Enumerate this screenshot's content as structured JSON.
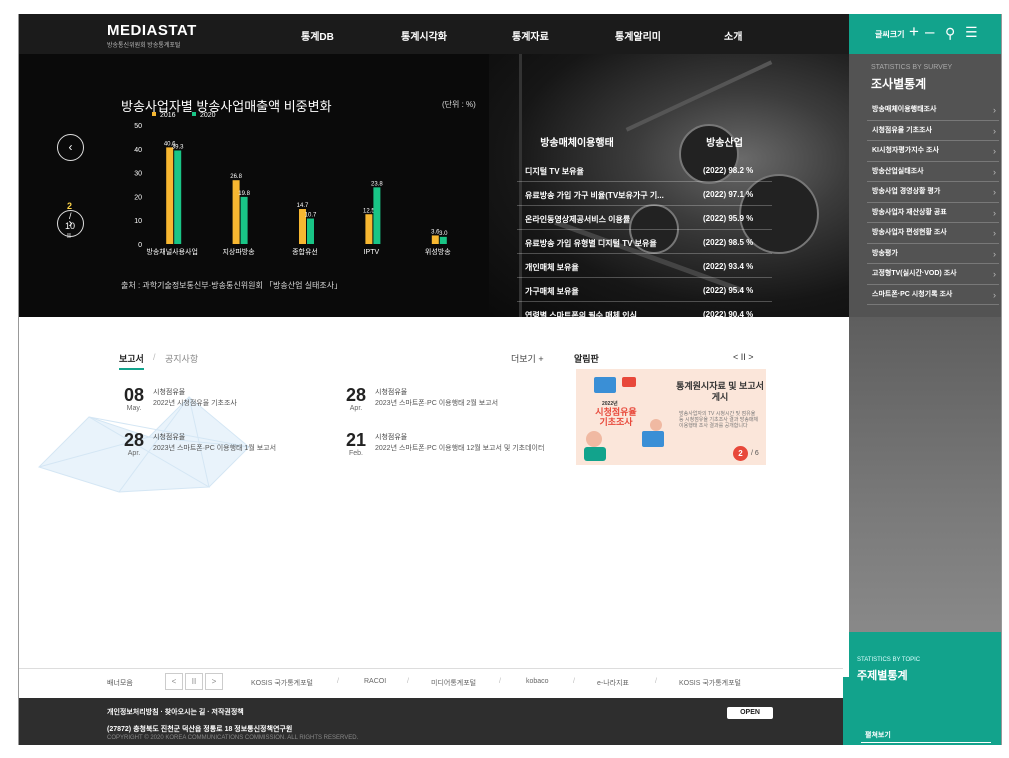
{
  "header": {
    "logo": "MEDIASTAT",
    "logo_sub": "방송통신위원회 방송통계포털",
    "nav": [
      "통계DB",
      "통계시각화",
      "통계자료",
      "통계알리미",
      "소개"
    ],
    "font_size_label": "글씨크기",
    "accent": "#12a38c"
  },
  "hero": {
    "chart_title": "방송사업자별 방송사업매출액 비중변화",
    "chart_unit": "(단위 : %)",
    "chart_source": "출처 : 과학기술정보통신부·방송통신위원회 「방송산업 실태조사」",
    "pager": {
      "current": "2",
      "slash": "/",
      "total": "10",
      "pause": "II"
    },
    "stat_tabs": [
      "방송매체이용행태",
      "방송산업"
    ],
    "stats": [
      {
        "label": "디지털 TV 보유율",
        "value": "(2022) 98.2 %"
      },
      {
        "label": "유료방송 가입 가구 비율(TV보유가구 기...",
        "value": "(2022) 97.1 %"
      },
      {
        "label": "온라인동영상제공서비스 이용률",
        "value": "(2022) 95.9 %"
      },
      {
        "label": "유료방송 가입 유형별 디지털 TV 보유율",
        "value": "(2022) 98.5 %"
      },
      {
        "label": "개인매체 보유율",
        "value": "(2022) 93.4 %"
      },
      {
        "label": "가구매체 보유율",
        "value": "(2022) 95.4 %"
      },
      {
        "label": "연령별 스마트폰의 필수 매체 인식",
        "value": "(2022) 90.4 %"
      }
    ]
  },
  "chart_data": {
    "type": "bar",
    "title": "방송사업자별 방송사업매출액 비중변화",
    "ylabel": "",
    "xlabel": "",
    "ylim": [
      0,
      50
    ],
    "yticks": [
      0,
      10,
      20,
      30,
      40,
      50
    ],
    "categories": [
      "방송채널사용사업",
      "지상파방송",
      "종합유선",
      "IPTV",
      "위성방송"
    ],
    "series": [
      {
        "name": "2016",
        "values": [
          40.6,
          26.8,
          14.7,
          12.5,
          3.6
        ],
        "color": "#f7b731"
      },
      {
        "name": "2020",
        "values": [
          39.3,
          19.8,
          10.7,
          23.8,
          3.0
        ],
        "color": "#19c586"
      }
    ],
    "legend_position": "top-left",
    "grid": false
  },
  "sidebar": {
    "survey_en": "STATISTICS BY SURVEY",
    "survey_ko": "조사별통계",
    "items": [
      "방송매체이용행태조사",
      "시청점유율 기초조사",
      "KI시청자평가지수 조사",
      "방송산업실태조사",
      "방송사업 경영상황 평가",
      "방송사업자 재산상황 공표",
      "방송사업자 편성현황 조사",
      "방송평가",
      "고정형TV(실시간·VOD) 조사",
      "스마트폰·PC 시청기록 조사"
    ],
    "topic_en": "STATISTICS BY TOPIC",
    "topic_ko": "주제별통계",
    "expand": "펼쳐보기"
  },
  "news": {
    "tab_reports": "보고서",
    "tab_sep": "/",
    "tab_notice": "공지사항",
    "more": "더보기 +",
    "items": [
      {
        "day": "08",
        "month": "May.",
        "category": "시청점유율",
        "title": "2022년 시청점유율 기초조사"
      },
      {
        "day": "28",
        "month": "Apr.",
        "category": "시청점유율",
        "title": "2023년 스마트폰·PC 이용행태 2월 보고서"
      },
      {
        "day": "28",
        "month": "Apr.",
        "category": "시청점유율",
        "title": "2023년 스마트폰·PC 이용행태 1월 보고서"
      },
      {
        "day": "21",
        "month": "Feb.",
        "category": "시청점유율",
        "title": "2022년 스마트폰·PC 이용행태 12월 보고서 및 기초데이터"
      }
    ]
  },
  "notice": {
    "title": "알림판",
    "controls": "< II >",
    "banner_title": "통계원시자료 및 보고서 게시",
    "banner_body": "방송사업자의 TV 시청시간 및 점유율 등 시청점유율 기초조사 결과 방송매체 이용행태 조사 결과를 공개합니다",
    "banner_year": "2022년",
    "banner_tag": "시청점유율 기초조사",
    "page_current": "2",
    "page_total": "/ 6"
  },
  "links": {
    "label": "배너모음",
    "controls": [
      "<",
      "II",
      ">"
    ],
    "items": [
      "KOSIS 국가통계포털",
      "RACOI",
      "미디어통계포털",
      "kobaco",
      "e-나라지표",
      "KOSIS 국가통계포털"
    ],
    "sep": "/"
  },
  "footer": {
    "links": "개인정보처리방침 · 찾아오시는 길 · 저작권정책",
    "address": "(27872) 충청북도 진천군 덕산읍 정통로 18 정보통신정책연구원",
    "copyright": "COPYRIGHT © 2020 KOREA COMMUNICATIONS COMMISSION. ALL RIGHTS RESERVED.",
    "badge": "OPEN"
  }
}
